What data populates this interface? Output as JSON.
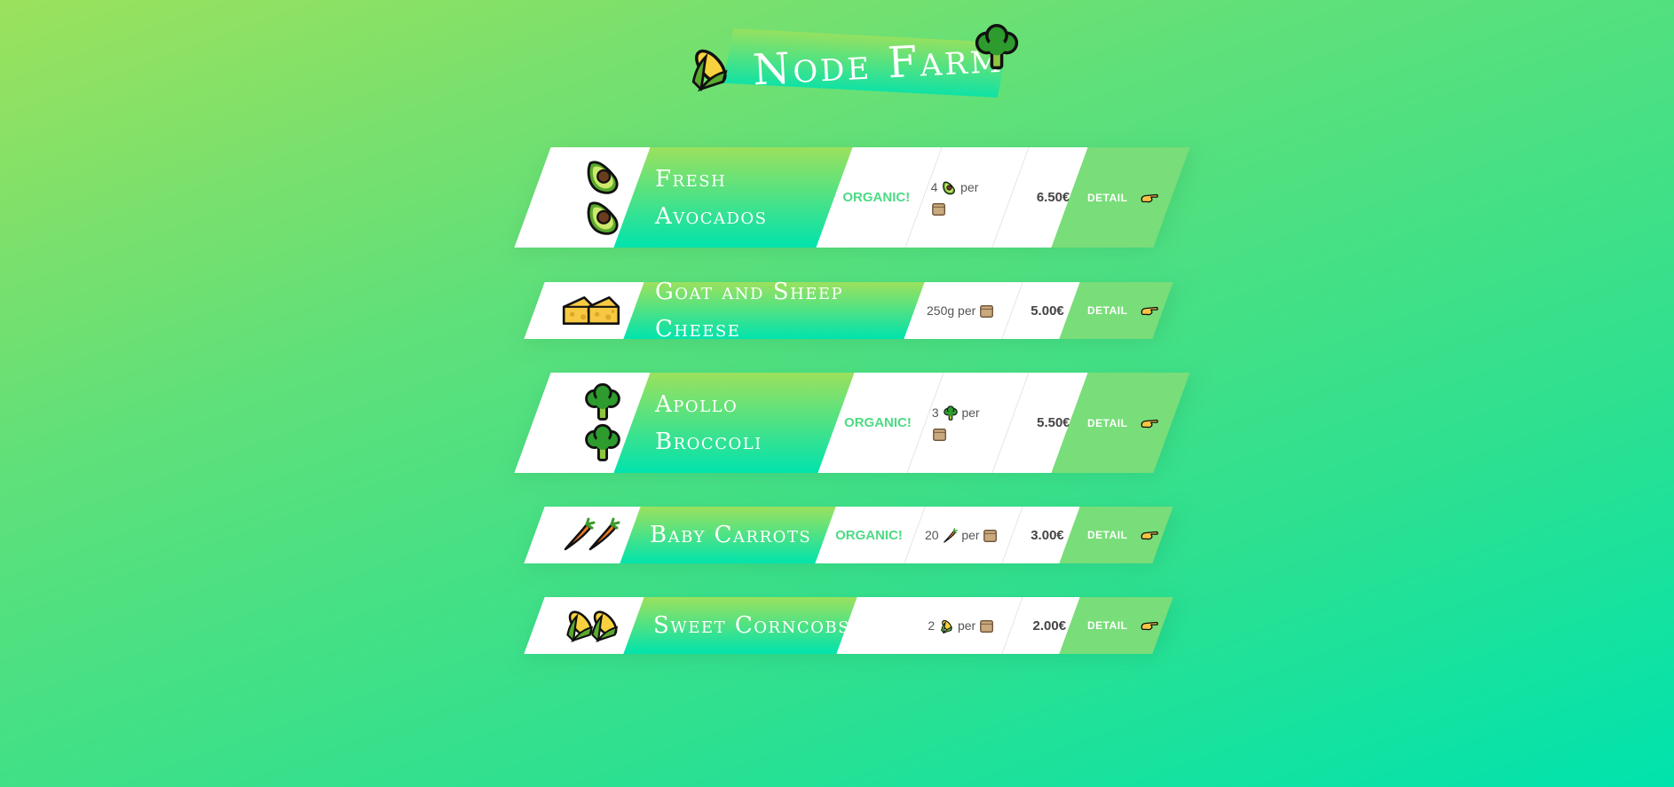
{
  "header": {
    "title": "Node Farm"
  },
  "products": [
    {
      "name": "Fresh Avocados",
      "organic": "ORGANIC!",
      "qty_num": "4",
      "qty_per": "per",
      "price": "6.50€",
      "detail": "DETAIL",
      "icon": "avocado-icon"
    },
    {
      "name": "Goat and Sheep Cheese",
      "organic": "",
      "qty_num": "250g",
      "qty_per": "per",
      "price": "5.00€",
      "detail": "DETAIL",
      "icon": "cheese-icon"
    },
    {
      "name": "Apollo Broccoli",
      "organic": "ORGANIC!",
      "qty_num": "3",
      "qty_per": "per",
      "price": "5.50€",
      "detail": "DETAIL",
      "icon": "broccoli-icon"
    },
    {
      "name": "Baby Carrots",
      "organic": "ORGANIC!",
      "qty_num": "20",
      "qty_per": "per",
      "price": "3.00€",
      "detail": "DETAIL",
      "icon": "carrot-icon"
    },
    {
      "name": "Sweet Corncobs",
      "organic": "",
      "qty_num": "2",
      "qty_per": "per",
      "price": "2.00€",
      "detail": "DETAIL",
      "icon": "corn-icon"
    }
  ],
  "colors": {
    "accent_green": "#4ddb84",
    "detail_bg": "#79dd79",
    "gradient_top": "#9be15d",
    "gradient_bottom": "#00e3ad"
  }
}
